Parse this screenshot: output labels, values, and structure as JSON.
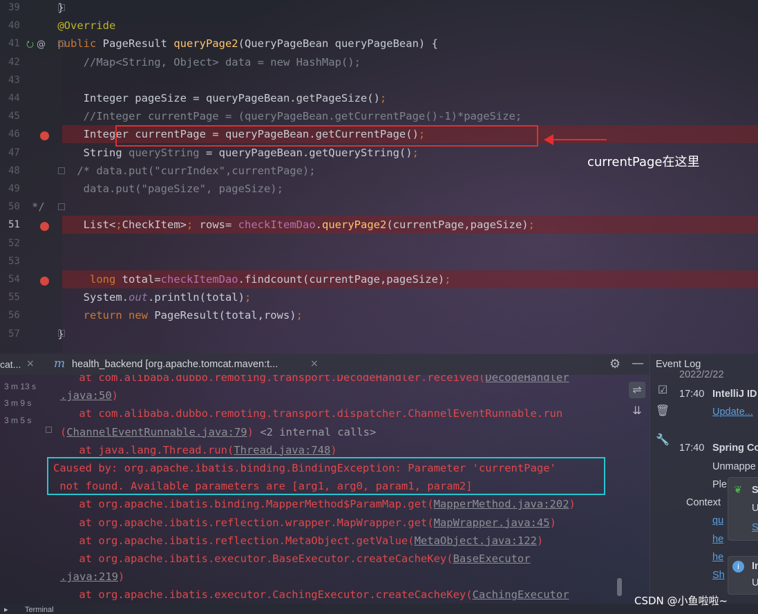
{
  "editor": {
    "lines": [
      {
        "num": "39",
        "text": "    }"
      },
      {
        "num": "40",
        "text": "    @Override"
      },
      {
        "num": "41",
        "text": "    public PageResult queryPage2(QueryPageBean queryPageBean) {"
      },
      {
        "num": "42",
        "text": "        //Map<String, Object> data = new HashMap();"
      },
      {
        "num": "43",
        "text": ""
      },
      {
        "num": "44",
        "text": "        Integer pageSize = queryPageBean.getPageSize();"
      },
      {
        "num": "45",
        "text": "        //Integer currentPage = (queryPageBean.getCurrentPage()-1)*pageSize;"
      },
      {
        "num": "46",
        "text": "        Integer currentPage = queryPageBean.getCurrentPage();"
      },
      {
        "num": "47",
        "text": "        String queryString = queryPageBean.getQueryString();"
      },
      {
        "num": "48",
        "text": "       /* data.put(\"currIndex\",currentPage);"
      },
      {
        "num": "49",
        "text": "        data.put(\"pageSize\", pageSize);"
      },
      {
        "num": "50",
        "text": "*/"
      },
      {
        "num": "51",
        "text": "        List<CheckItem> rows= checkItemDao.queryPage2(currentPage,pageSize);"
      },
      {
        "num": "52",
        "text": ""
      },
      {
        "num": "53",
        "text": ""
      },
      {
        "num": "54",
        "text": "         long total=checkItemDao.findcount(currentPage,pageSize);"
      },
      {
        "num": "55",
        "text": "        System.out.println(total);"
      },
      {
        "num": "56",
        "text": "        return new PageResult(total,rows);"
      },
      {
        "num": "57",
        "text": "    }"
      }
    ],
    "annotation_note": "currentPage在这里"
  },
  "tool_window": {
    "tab_first": "cat...",
    "tab_second": "health_backend [org.apache.tomcat.maven:t...",
    "left_times": [
      "3 m 13 s",
      "3 m 9 s",
      "3 m 5 s"
    ],
    "console_lines": [
      {
        "pre": "    at com.alibaba.dubbo.remoting.transport.DecodeHandler.received(",
        "link": "DecodeHandler",
        "post": ""
      },
      {
        "pre": "",
        "link": ".java:50",
        "post": ")"
      },
      {
        "pre": "    at com.alibaba.dubbo.remoting.transport.dispatcher.ChannelEventRunnable.run",
        "link": "",
        "post": ""
      },
      {
        "pre": "(",
        "link": "ChannelEventRunnable.java:79",
        "post": ") ",
        "grey": "<2 internal calls>"
      },
      {
        "pre": "    at java.lang.Thread.run(",
        "link": "Thread.java:748",
        "post": ")"
      },
      {
        "pre": "Caused by: org.apache.ibatis.binding.BindingException: Parameter 'currentPage'",
        "link": "",
        "post": ""
      },
      {
        "pre": " not found. Available parameters are [arg1, arg0, param1, param2]",
        "link": "",
        "post": ""
      },
      {
        "pre": "    at org.apache.ibatis.binding.MapperMethod$ParamMap.get(",
        "link": "MapperMethod.java:202",
        "post": ")"
      },
      {
        "pre": "    at org.apache.ibatis.reflection.wrapper.MapWrapper.get(",
        "link": "MapWrapper.java:45",
        "post": ")"
      },
      {
        "pre": "    at org.apache.ibatis.reflection.MetaObject.getValue(",
        "link": "MetaObject.java:122",
        "post": ")"
      },
      {
        "pre": "    at org.apache.ibatis.executor.BaseExecutor.createCacheKey(",
        "link": "BaseExecutor",
        "post": ""
      },
      {
        "pre": "",
        "link": ".java:219",
        "post": ")"
      },
      {
        "pre": "    at org.apache.ibatis.executor.CachingExecutor.createCacheKey(",
        "link": "CachingExecutor",
        "post": ""
      }
    ],
    "terminal_label": "Terminal"
  },
  "event_log": {
    "title": "Event Log",
    "date": "2022/2/22",
    "entries": [
      {
        "time": "17:40",
        "title": "IntelliJ ID",
        "link": "Update..."
      },
      {
        "time": "17:40",
        "title": "Spring Co",
        "lines": [
          "Unmappe",
          "Ple"
        ]
      }
    ],
    "context_label": "Context",
    "context_links": [
      "qu",
      "he",
      "he",
      "Sh"
    ],
    "popup1": {
      "title": "S",
      "lines": [
        "U",
        "S"
      ]
    },
    "popup2": {
      "title": "In",
      "lines": [
        "U"
      ]
    }
  },
  "colors": {
    "breakpoint": "#d6483f",
    "error_text": "#e0484a",
    "highlight_box": "#e03030",
    "cyan_box": "#26c6d0",
    "keyword": "#cc7832"
  },
  "watermark": "CSDN @小鱼啦啦~"
}
